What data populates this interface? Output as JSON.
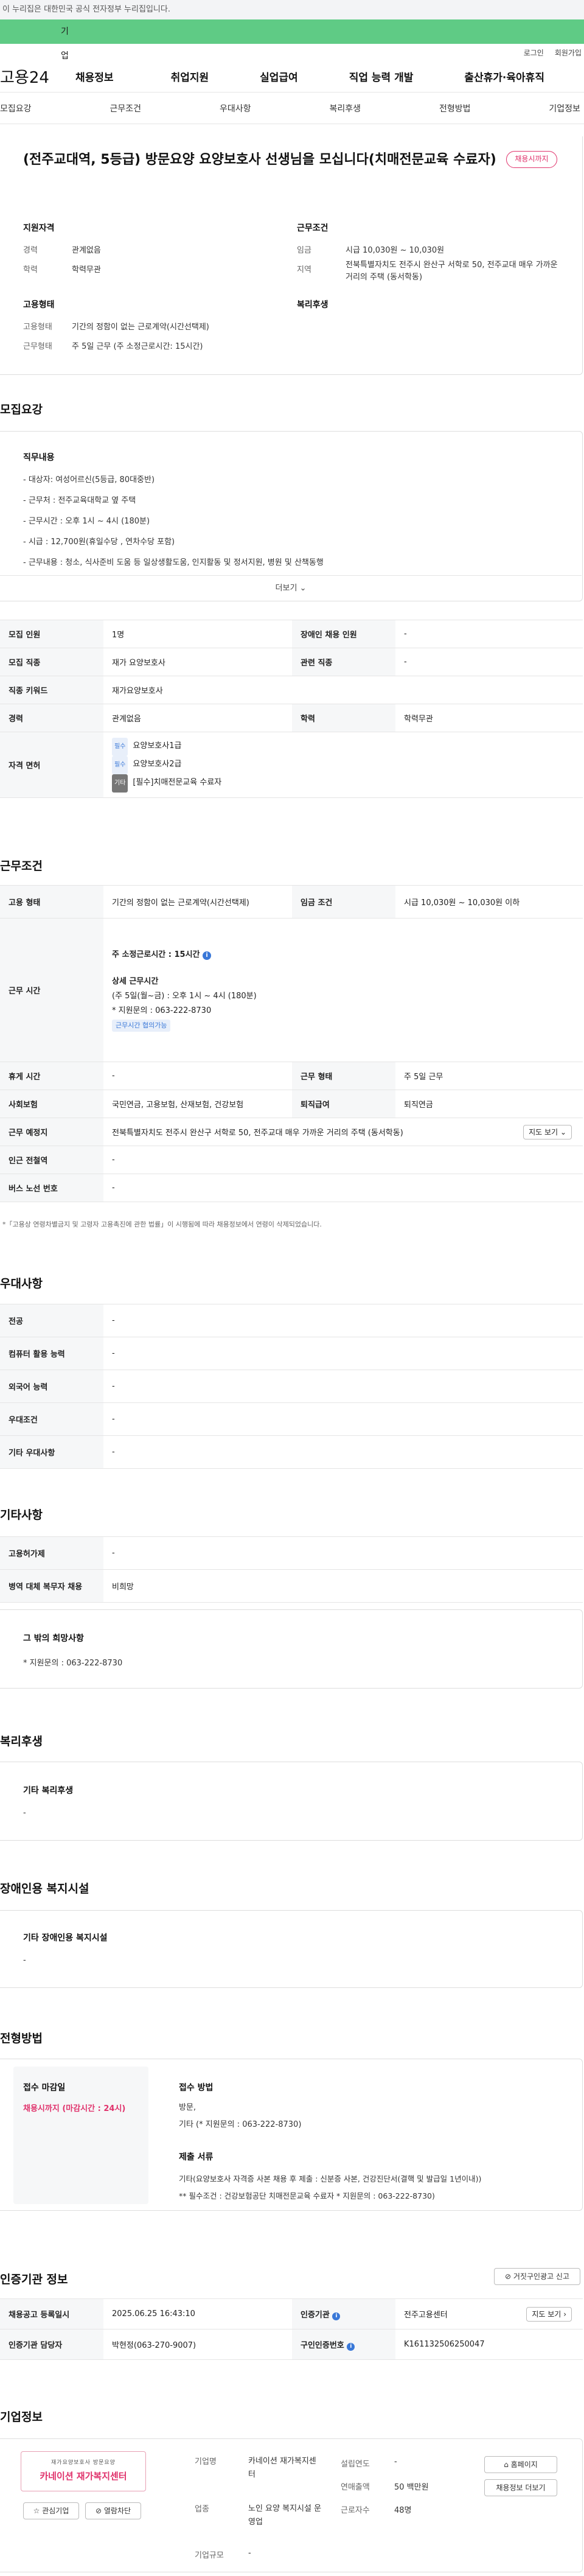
{
  "gov_banner": "이 누리집은 대한민국 공식 전자정부 누리집입니다.",
  "user_tabs": [
    "개인",
    "기업"
  ],
  "top_links": [
    "로그인",
    "회원가입"
  ],
  "logo": "고용24",
  "gnb": [
    "채용정보",
    "취업지원",
    "실업급여",
    "직업 능력 개발",
    "출산휴가·육아휴직"
  ],
  "subnav": [
    "모집요강",
    "근무조건",
    "우대사항",
    "복리후생",
    "전형방법",
    "기업정보"
  ],
  "job_title": "(전주교대역, 5등급) 방문요양 요양보호사 선생님을 모십니다(치매전문교육 수료자)",
  "status_badge": "채용시까지",
  "summary": {
    "qual_title": "지원자격",
    "career_label": "경력",
    "career_value": "관계없음",
    "edu_label": "학력",
    "edu_value": "학력무관",
    "emp_title": "고용형태",
    "emp_type_label": "고용형태",
    "emp_type_value": "기간의 정함이 없는 근로계약(시간선택제)",
    "work_form_label": "근무형태",
    "work_form_value": "주 5일 근무 (주 소정근로시간: 15시간)",
    "cond_title": "근무조건",
    "wage_label": "임금",
    "wage_value": "시급 10,030원 ~ 10,030원",
    "loc_label": "지역",
    "loc_value": "전북특별자치도 전주시 완산구 서학로 50, 전주교대 매우 가까운 거리의 주택 (동서학동)",
    "welfare_title": "복리후생"
  },
  "recruit": {
    "title": "모집요강",
    "duty_title": "직무내용",
    "duties": [
      "- 대상자: 여성어르신(5등급, 80대중반)",
      "- 근무처 : 전주교육대학교 옆 주택",
      "- 근무시간 : 오후 1시 ~ 4시 (180분)",
      "- 시급 : 12,700원(휴일수당 , 연차수당 포함)",
      "- 근무내용 : 청소, 식사준비 도움 등 일상생활도움, 인지활동 및 정서지원, 병원 및 산책동행"
    ],
    "more": "더보기",
    "rows": {
      "count_label": "모집 인원",
      "count_value": "1명",
      "disabled_label": "장애인 채용 인원",
      "disabled_value": "-",
      "job_label": "모집 직종",
      "job_value": "재가 요양보호사",
      "related_label": "관련 직종",
      "related_value": "-",
      "keyword_label": "직종 키워드",
      "keyword_value": "재가요양보호사",
      "career_label": "경력",
      "career_value": "관계없음",
      "edu_label": "학력",
      "edu_value": "학력무관",
      "license_label": "자격 면허",
      "licenses": [
        {
          "tag": "필수",
          "name": "요양보호사1급"
        },
        {
          "tag": "필수",
          "name": "요양보호사2급"
        },
        {
          "tag": "기타",
          "name": "[필수]치매전문교육 수료자"
        }
      ]
    }
  },
  "work": {
    "title": "근무조건",
    "emp_label": "고용 형태",
    "emp_value": "기간의 정함이 없는 근로계약(시간선택제)",
    "wage_label": "임금 조건",
    "wage_value": "시급 10,030원 ~ 10,030원 이하",
    "time_label": "근무 시간",
    "weekly_hours": "주 소정근로시간 : 15시간",
    "detail_title": "상세 근무시간",
    "detail_1": "(주 5일(월~금) : 오후 1시 ~ 4시 (180분)",
    "detail_2": "* 지원문의 : 063-222-8730",
    "detail_btn": "근무시간 협의가능",
    "rest_label": "휴게 시간",
    "rest_value": "-",
    "form_label": "근무 형태",
    "form_value": "주 5일 근무",
    "ins_label": "사회보험",
    "ins_value": "국민연금, 고용보험, 산재보험, 건강보험",
    "retire_label": "퇴직급여",
    "retire_value": "퇴직연금",
    "place_label": "근무 예정지",
    "place_value": "전북특별자치도 전주시 완산구 서학로 50, 전주교대 매우 가까운 거리의 주택 (동서학동)",
    "map_btn": "지도 보기",
    "subway_label": "인근 전철역",
    "subway_value": "-",
    "bus_label": "버스 노선 번호",
    "bus_value": "-",
    "notice": "*「고용상 연령차별금지 및 고령자 고용촉진에 관한 법률」이 시행됨에 따라 채용정보에서 연령이 삭제되었습니다."
  },
  "prefer": {
    "title": "우대사항",
    "rows": [
      {
        "label": "전공",
        "value": "-"
      },
      {
        "label": "컴퓨터 활용 능력",
        "value": "-"
      },
      {
        "label": "외국어 능력",
        "value": "-"
      },
      {
        "label": "우대조건",
        "value": "-"
      },
      {
        "label": "기타 우대사항",
        "value": "-"
      }
    ]
  },
  "etc": {
    "title": "기타사항",
    "subsidy_label": "고용허가제",
    "subsidy_value": "-",
    "army_label": "병역 대체 복무자 채용",
    "army_value": "비희망",
    "other_title": "그 밖의 희망사항",
    "other_value": "* 지원문의 : 063-222-8730"
  },
  "welfare": {
    "title": "복리후생",
    "box_title": "기타 복리후생",
    "box_value": "-"
  },
  "disabled": {
    "title": "장애인용 복지시설",
    "box_title": "기타 장애인용 복지시설",
    "box_value": "-"
  },
  "method": {
    "title": "전형방법",
    "deadline_title": "접수 마감일",
    "deadline_value": "채용시까지 (마감시간 : 24시)",
    "apply_title": "접수 방법",
    "apply_1": "방문,",
    "apply_2": "기타 (* 지원문의 : 063-222-8730)",
    "docs_title": "제출 서류",
    "docs_1": "기타(요양보호사 자격증 사본  채용 후 제출 : 신분증 사본, 건강진단서(결핵 및 발급일 1년이내))",
    "docs_2": "** 필수조건 : 건강보험공단 치매전문교육 수료자 * 지원문의 : 063-222-8730)"
  },
  "agency": {
    "title": "인증기관 정보",
    "report_btn": "거짓구인광고 신고",
    "reg_label": "채용공고 등록일시",
    "reg_value": "2025.06.25 16:43:10",
    "agency_label": "인증기관",
    "agency_value": "전주고용센터",
    "map_btn": "지도 보기",
    "manager_label": "인증기관 담당자",
    "manager_value": "박현정(063-270-9007)",
    "id_label": "구인인증번호",
    "id_value": "K161132506250047"
  },
  "company": {
    "title": "기업정보",
    "logo_small": "재가요양보호사 방문요양",
    "logo_name": "카네이션 재가복지센터",
    "fav_btn": "관심기업",
    "block_btn": "열람차단",
    "name_label": "기업명",
    "name_value": "카네이션 재가복지센터",
    "year_label": "설립연도",
    "year_value": "-",
    "sales_label": "연매출액",
    "sales_value": "50 백만원",
    "industry_label": "업종",
    "industry_value": "노인 요양 복지시설 운영업",
    "staff_label": "근로자수",
    "staff_value": "48명",
    "scale_label": "기업규모",
    "scale_value": "-",
    "home_btn": "홈페이지",
    "jobs_btn": "채용정보 더보기"
  },
  "colors": {
    "green": "#5fcb85",
    "pink": "#e0336c",
    "blue": "#3a78d8"
  }
}
